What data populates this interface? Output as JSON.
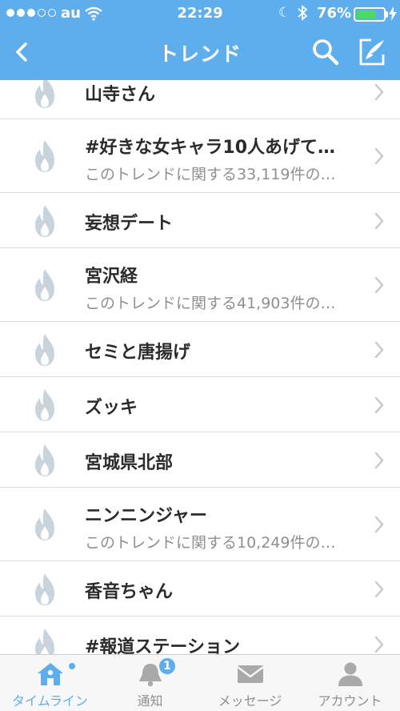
{
  "status_bar": {
    "carrier": "au",
    "time": "22:29",
    "battery_text": "76%",
    "battery_level": 0.76,
    "signal_bars_filled": 3,
    "signal_bars_total": 5
  },
  "nav": {
    "title": "トレンド",
    "back_icon": "chevron-left-icon",
    "search_icon": "search-icon",
    "compose_icon": "compose-icon"
  },
  "trends": [
    {
      "title": "山寺さん",
      "subtitle": ""
    },
    {
      "title": "#好きな女キャラ10人あげて…",
      "subtitle": "このトレンドに関する33,119件の…"
    },
    {
      "title": "妄想デート",
      "subtitle": ""
    },
    {
      "title": "宮沢経",
      "subtitle": "このトレンドに関する41,903件の…"
    },
    {
      "title": "セミと唐揚げ",
      "subtitle": ""
    },
    {
      "title": "ズッキ",
      "subtitle": ""
    },
    {
      "title": "宮城県北部",
      "subtitle": ""
    },
    {
      "title": "ニンニンジャー",
      "subtitle": "このトレンドに関する10,249件の…"
    },
    {
      "title": "香音ちゃん",
      "subtitle": ""
    },
    {
      "title": "#報道ステーション",
      "subtitle": ""
    }
  ],
  "tabbar": {
    "tabs": [
      {
        "label": "タイムライン",
        "icon": "home-icon",
        "active": true
      },
      {
        "label": "通知",
        "icon": "bell-icon",
        "active": false,
        "badge": "1"
      },
      {
        "label": "メッセージ",
        "icon": "envelope-icon",
        "active": false
      },
      {
        "label": "アカウント",
        "icon": "person-icon",
        "active": false
      }
    ]
  },
  "colors": {
    "accent": "#5EAEEE",
    "icon_gray": "#C9D3DB",
    "battery_green": "#4CD964"
  }
}
